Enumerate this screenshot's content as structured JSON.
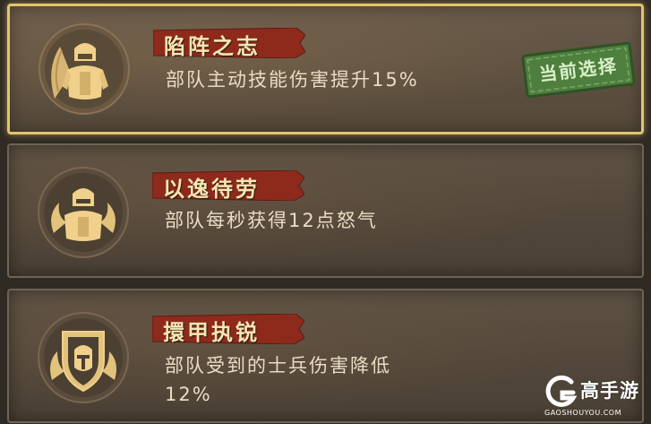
{
  "skills": [
    {
      "title": "陷阵之志",
      "desc_lines": [
        "部队主动技能伤害提升15%"
      ],
      "icon": "soldier-banner-icon",
      "selected": true
    },
    {
      "title": "以逸待劳",
      "desc_lines": [
        "部队每秒获得12点怒气"
      ],
      "icon": "soldier-flame-icon",
      "selected": false
    },
    {
      "title": "擐甲执锐",
      "desc_lines": [
        "部队受到的士兵伤害降低",
        "12%"
      ],
      "icon": "shield-helmet-icon",
      "selected": false
    }
  ],
  "badge": {
    "label": "当前选择",
    "color": "#4f7f3e"
  },
  "watermark": {
    "name": "高手游",
    "url": "GAOSHOUYOU.COM"
  },
  "colors": {
    "accent_gold": "#e2c46e",
    "ribbon_red": "#8e2a1c",
    "title_text": "#f6e6b4",
    "desc_text": "#e8dcc4"
  }
}
